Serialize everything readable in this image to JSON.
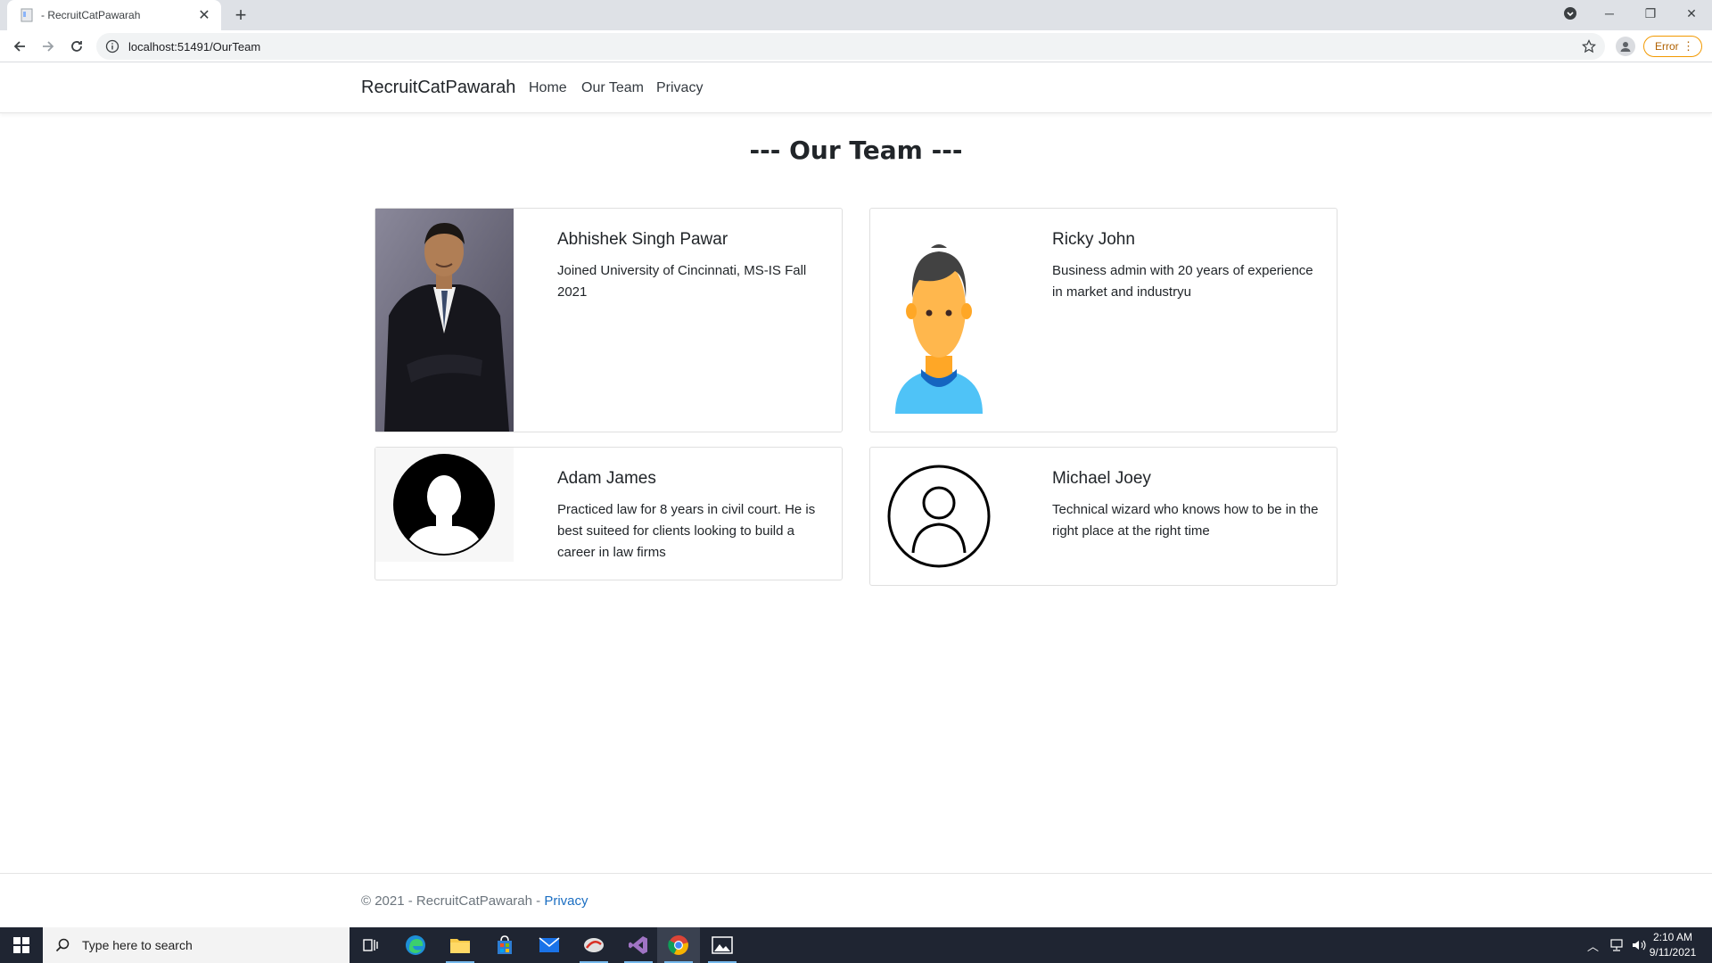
{
  "browser": {
    "tab_title": "- RecruitCatPawarah",
    "url": "localhost:51491/OurTeam",
    "error_label": "Error"
  },
  "site": {
    "brand": "RecruitCatPawarah",
    "nav": [
      "Home",
      "Our Team",
      "Privacy"
    ]
  },
  "page": {
    "title": "--- Our Team ---"
  },
  "team": [
    {
      "name": "Abhishek Singh Pawar",
      "description": "Joined University of Cincinnati, MS-IS Fall 2021",
      "avatar": "photo"
    },
    {
      "name": "Ricky John",
      "description": "Business admin with 20 years of experience in market and industryu",
      "avatar": "cartoon-person-icon"
    },
    {
      "name": "Adam James",
      "description": "Practiced law for 8 years in civil court. He is best suiteed for clients looking to build a career in law firms",
      "avatar": "person-silhouette-icon"
    },
    {
      "name": "Michael Joey",
      "description": "Technical wizard who knows how to be in the right place at the right time",
      "avatar": "person-outline-icon"
    }
  ],
  "footer": {
    "text": "© 2021 - RecruitCatPawarah - ",
    "link": "Privacy"
  },
  "taskbar": {
    "search_placeholder": "Type here to search",
    "time": "2:10 AM",
    "date": "9/11/2021"
  }
}
